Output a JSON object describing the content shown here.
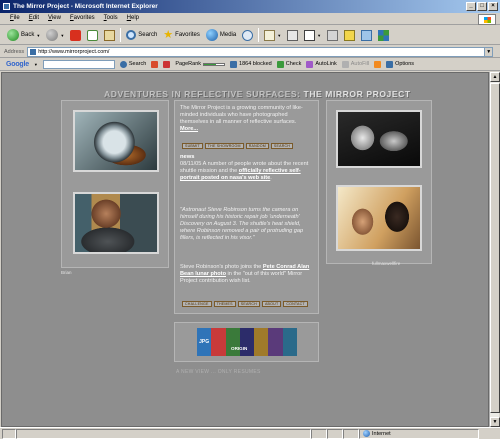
{
  "window": {
    "title": "The Mirror Project - Microsoft Internet Explorer",
    "min": "_",
    "max": "□",
    "close": "×"
  },
  "menu": [
    "File",
    "Edit",
    "View",
    "Favorites",
    "Tools",
    "Help"
  ],
  "toolbar": {
    "back": "Back",
    "search": "Search",
    "favorites": "Favorites",
    "media": "Media"
  },
  "address": {
    "label": "Address",
    "url": "http://www.mirrorproject.com/",
    "go": "Go",
    "links": "Links"
  },
  "google": {
    "logo": "Google",
    "search": "Search",
    "pagerank": "PageRank",
    "blocked": "1864 blocked",
    "check": "Check",
    "autolink": "AutoLink",
    "autofill": "AutoFill",
    "options": "Options"
  },
  "page": {
    "title_part1": "ADVENTURES IN REFLECTIVE SURFACES: ",
    "title_part2": "THE MIRROR PROJECT",
    "intro": "The Mirror Project is a growing community of like-minded individuals who have photographed themselves in all manner of reflective surfaces.",
    "intro_link": "More...",
    "buttons_top": [
      "Submit",
      "The Showroom",
      "Random",
      "Search"
    ],
    "news_heading": "news",
    "news_date": "08/11/05",
    "news_text": " A number of people wrote about the recent shuttle mission and the ",
    "news_link": "officially reflective self-portrait posted on nasa's web site",
    "news_end": ".",
    "quote": "\"Astronaut Steve Robinson turns the camera on himself during his historic repair job 'underneath' Discovery on August 3. The shuttle's heat shield, where Robinson removed a pair of protruding gap fillers, is reflected in his visor.\"",
    "followup_pre": "Steve Robinson's photo joins the ",
    "followup_link": "Pete Conrad Alan Bean lunar photo",
    "followup_post": " in the \"out of this world\" Mirror Project contribution wish list.",
    "buttons_bottom": [
      "Challenge",
      "Themes",
      "Search",
      "About",
      "Contact"
    ],
    "caption_left": "Brian",
    "caption_right": "fullmaxwellfire",
    "ad_jpg": "JPG",
    "ad_origin": "ORIGIN",
    "bottom_text": "A NEW VIEW ... ONLY RESUMES"
  },
  "status": {
    "zone": "Internet"
  }
}
